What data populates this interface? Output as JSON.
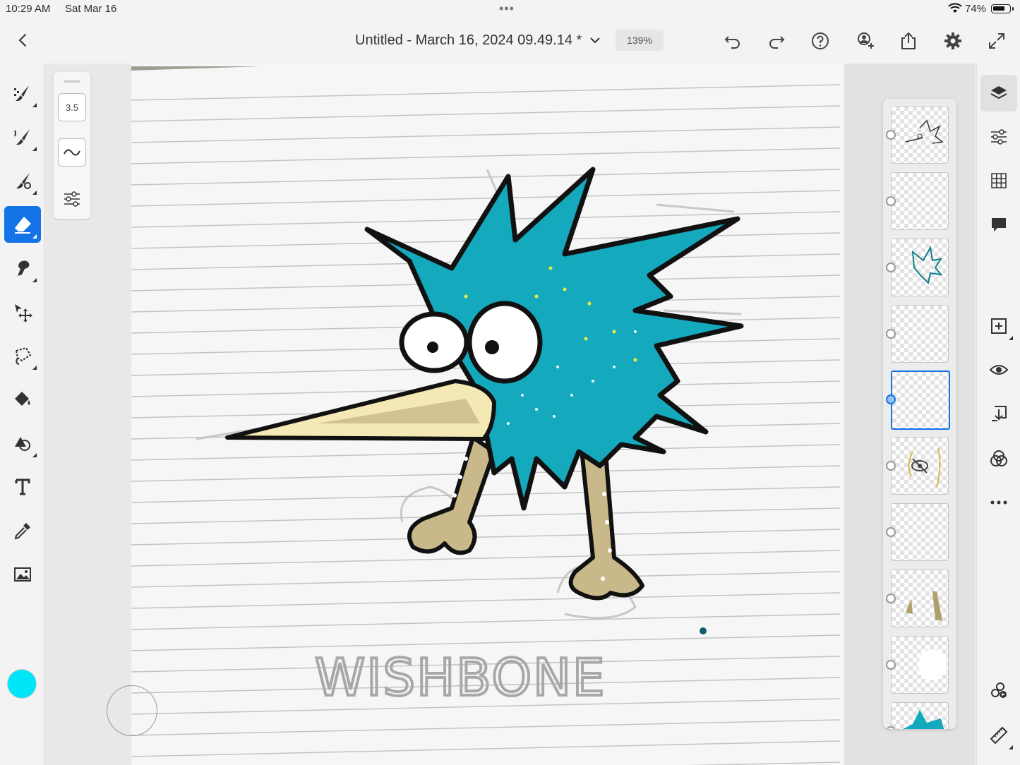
{
  "status_bar": {
    "time": "10:29 AM",
    "date": "Sat Mar 16",
    "battery": "74%",
    "battery_level": 0.74
  },
  "header": {
    "document_title": "Untitled - March 16, 2024 09.49.14 *",
    "zoom": "139%"
  },
  "tools": [
    "pixel-brush",
    "live-brush",
    "mixer-brush",
    "eraser",
    "smudge",
    "move-transform",
    "lasso-selection",
    "fill",
    "shape",
    "type",
    "eyedropper",
    "place-image"
  ],
  "active_tool": "eraser",
  "current_color": "#00e5f7",
  "tool_options": {
    "size": "3.5"
  },
  "canvas": {
    "handwritten_text": "WISHBONE"
  },
  "layers": {
    "count": 10,
    "selected_index": 4,
    "hidden_index": 5
  },
  "colors": {
    "accent": "#1473e6",
    "bird_teal": "#14a9bd",
    "beak": "#f4e8b4",
    "legs": "#c9b98a"
  }
}
